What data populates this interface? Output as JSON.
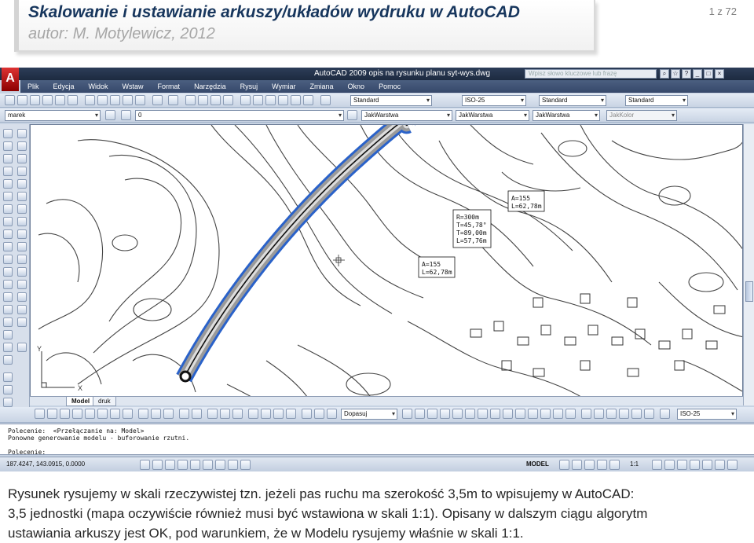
{
  "slide": {
    "title": "Skalowanie i ustawianie arkuszy/układów wydruku w AutoCAD",
    "author": "autor: M. Motylewicz, 2012",
    "page": "1 z 72"
  },
  "autocad": {
    "window_title": "AutoCAD 2009 opis na rysunku planu syt-wys.dwg",
    "search_placeholder": "Wpisz słowo kluczowe lub frazę",
    "menu": [
      "Plik",
      "Edycja",
      "Widok",
      "Wstaw",
      "Format",
      "Narzędzia",
      "Rysuj",
      "Wymiar",
      "Zmiana",
      "Okno",
      "Pomoc"
    ],
    "toolbar_styles": {
      "text_style": "Standard",
      "dim_style": "ISO-25",
      "table_style": "Standard",
      "mleader_style": "Standard"
    },
    "layer_bar": {
      "workspace": "marek",
      "layer": "0",
      "color": "JakWarstwa",
      "linetype": "JakWarstwa",
      "lineweight": "JakWarstwa",
      "plotstyle": "JakKolor"
    },
    "drawing_labels": {
      "curve1": [
        "A=155",
        "L=62,78m"
      ],
      "curve2": [
        "R=300m",
        "T=45,78°",
        "T=89,00m",
        "L=57,76m"
      ],
      "curve3": [
        "A=155",
        "L=62,78m"
      ],
      "axis_y": "Y",
      "axis_x": "X"
    },
    "tabs": [
      "Model",
      "druk"
    ],
    "bottom_toolbar": {
      "fit": "Dopasuj",
      "dim_style": "ISO-25"
    },
    "command_lines": [
      "Polecenie:  <Przełączanie na: Model>",
      "Ponowne generowanie modelu - buforowanie rzutni.",
      "",
      "Polecenie:"
    ],
    "status": {
      "coordinates": "187.4247, 143.0915, 0.0000",
      "space": "MODEL",
      "scale": "1:1"
    }
  },
  "caption": {
    "line1": "Rysunek rysujemy w skali rzeczywistej tzn. jeżeli pas ruchu ma szerokość 3,5m to wpisujemy w AutoCAD:",
    "line2": "3,5 jednostki (mapa oczywiście również musi być wstawiona w skali 1:1). Opisany w dalszym ciągu algorytm",
    "line3": "ustawiania arkuszy jest OK, pod warunkiem, że w Modelu rysujemy właśnie w skali 1:1."
  }
}
